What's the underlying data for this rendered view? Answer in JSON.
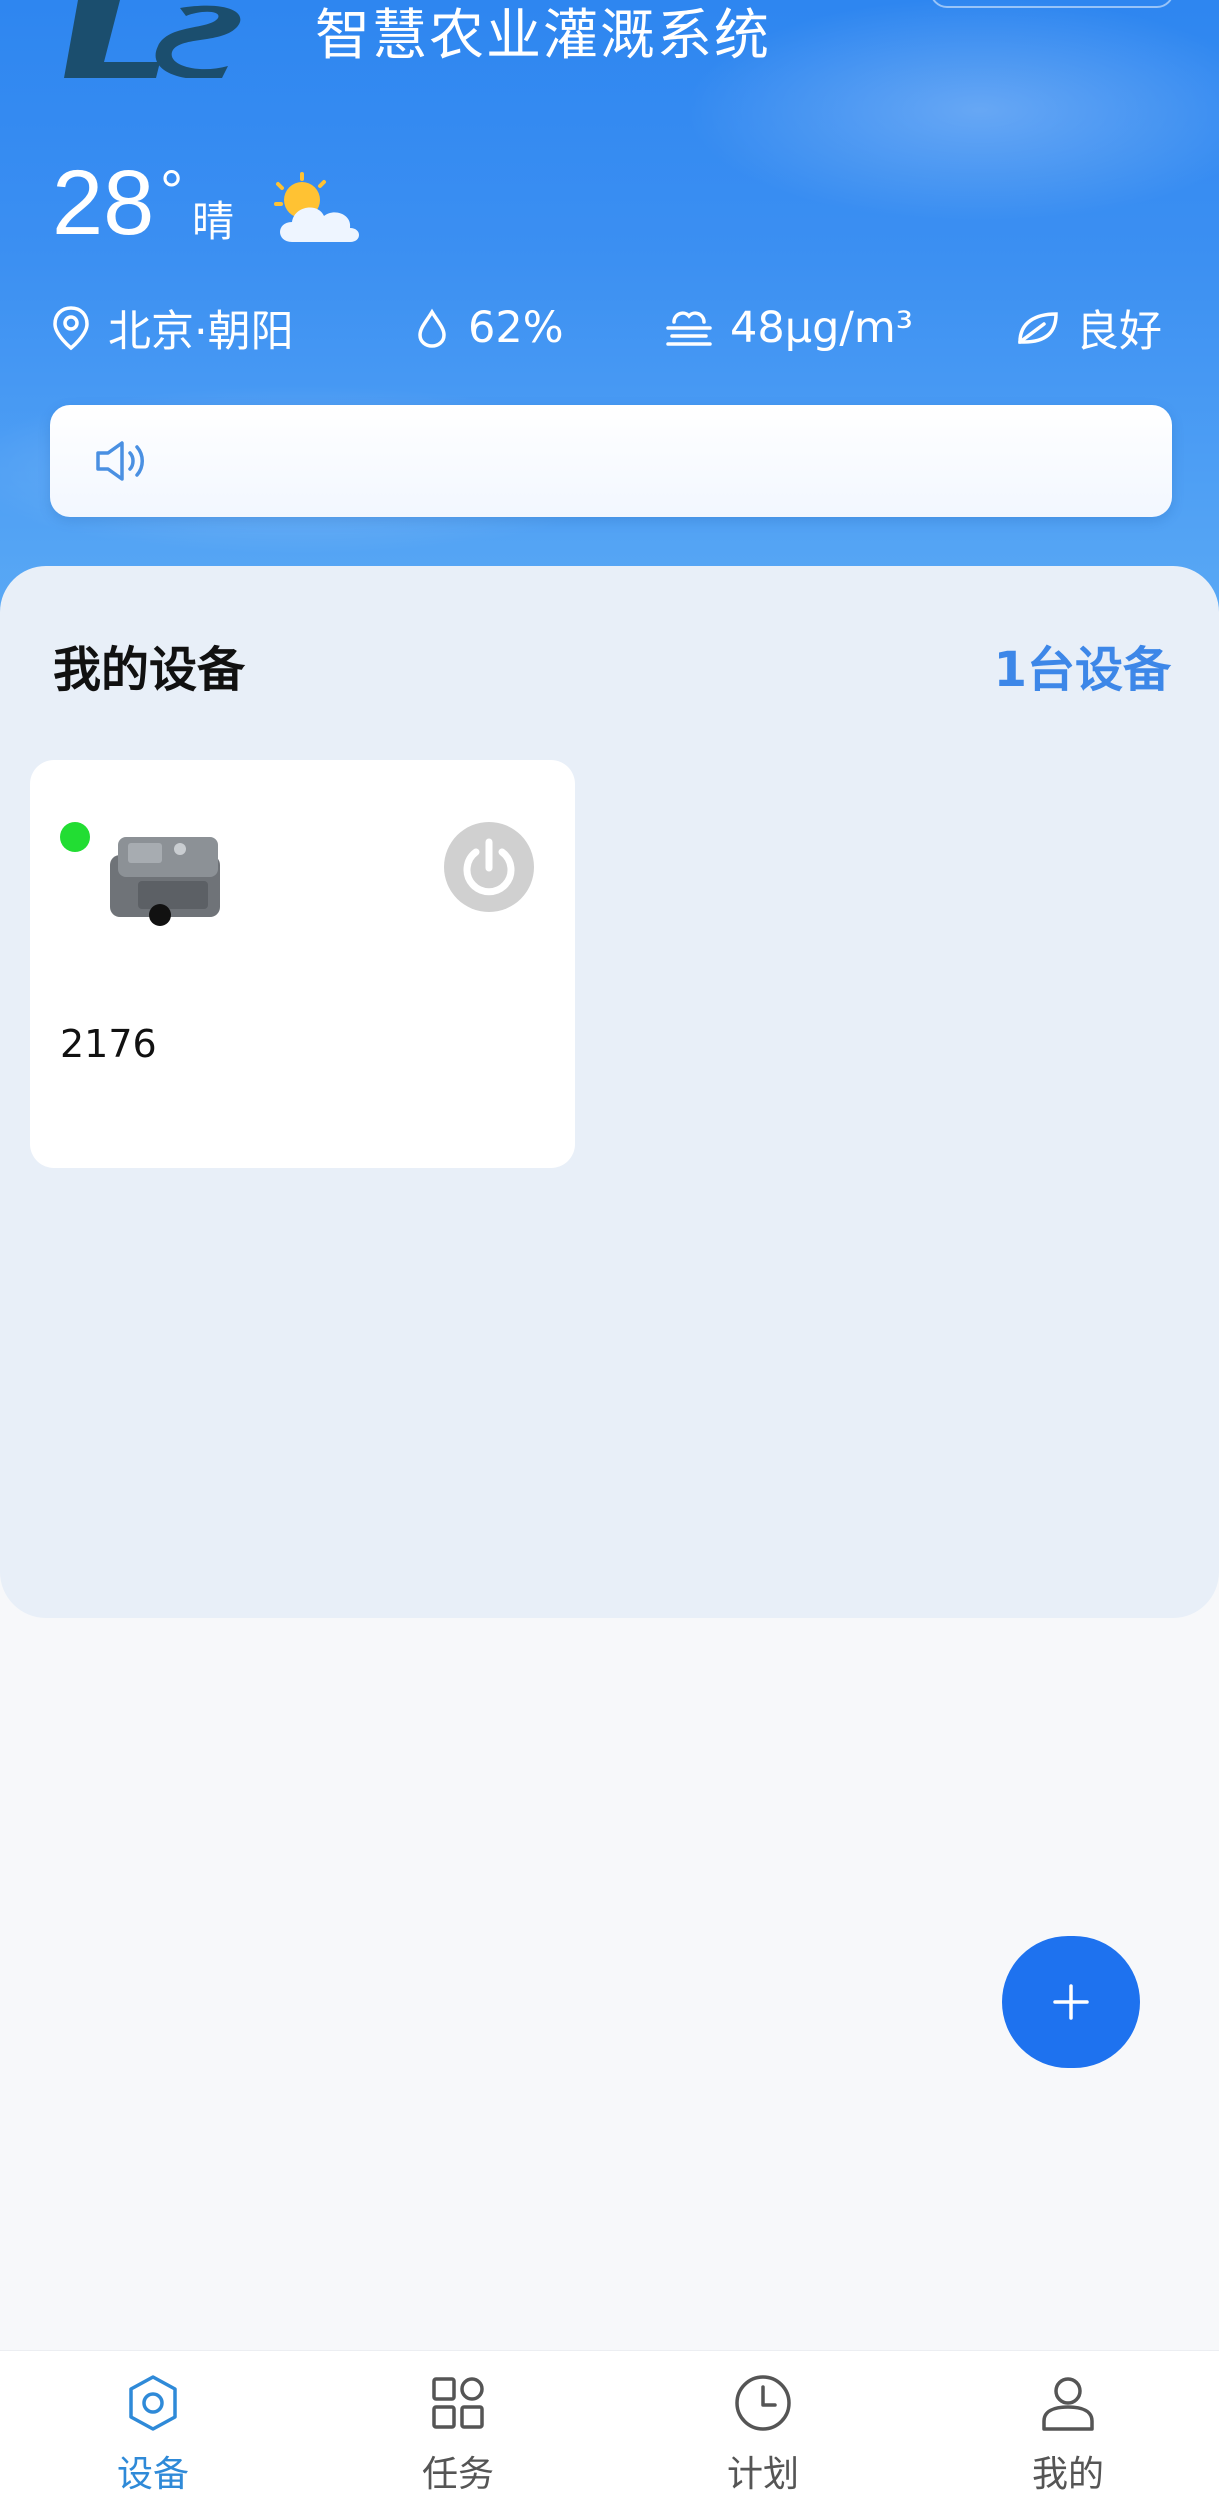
{
  "header": {
    "app_title": "智慧农业灌溉系统",
    "logo_text": "LS"
  },
  "weather": {
    "temperature": "28",
    "degree_symbol": "°",
    "condition": "晴",
    "condition_icon": "partly-cloudy-icon",
    "location": "北京·朝阳",
    "humidity": "62%",
    "pm": "48μg/m³",
    "air_quality": "良好"
  },
  "notice": {
    "icon": "speaker-icon",
    "text": ""
  },
  "devices": {
    "title": "我的设备",
    "count_label": "1台设备",
    "items": [
      {
        "name": "2176",
        "online": true,
        "status_color": "#22dd33"
      }
    ]
  },
  "fab": {
    "icon": "plus-icon"
  },
  "tabbar": {
    "items": [
      {
        "label": "设备",
        "icon": "gear-icon",
        "active": true
      },
      {
        "label": "任务",
        "icon": "grid-icon",
        "active": false
      },
      {
        "label": "计划",
        "icon": "clock-icon",
        "active": false
      },
      {
        "label": "我的",
        "icon": "user-icon",
        "active": false
      }
    ]
  },
  "colors": {
    "accent": "#1e72ef",
    "active_tab": "#2f8ad8",
    "count_text": "#3d87e8",
    "online": "#22dd33"
  }
}
